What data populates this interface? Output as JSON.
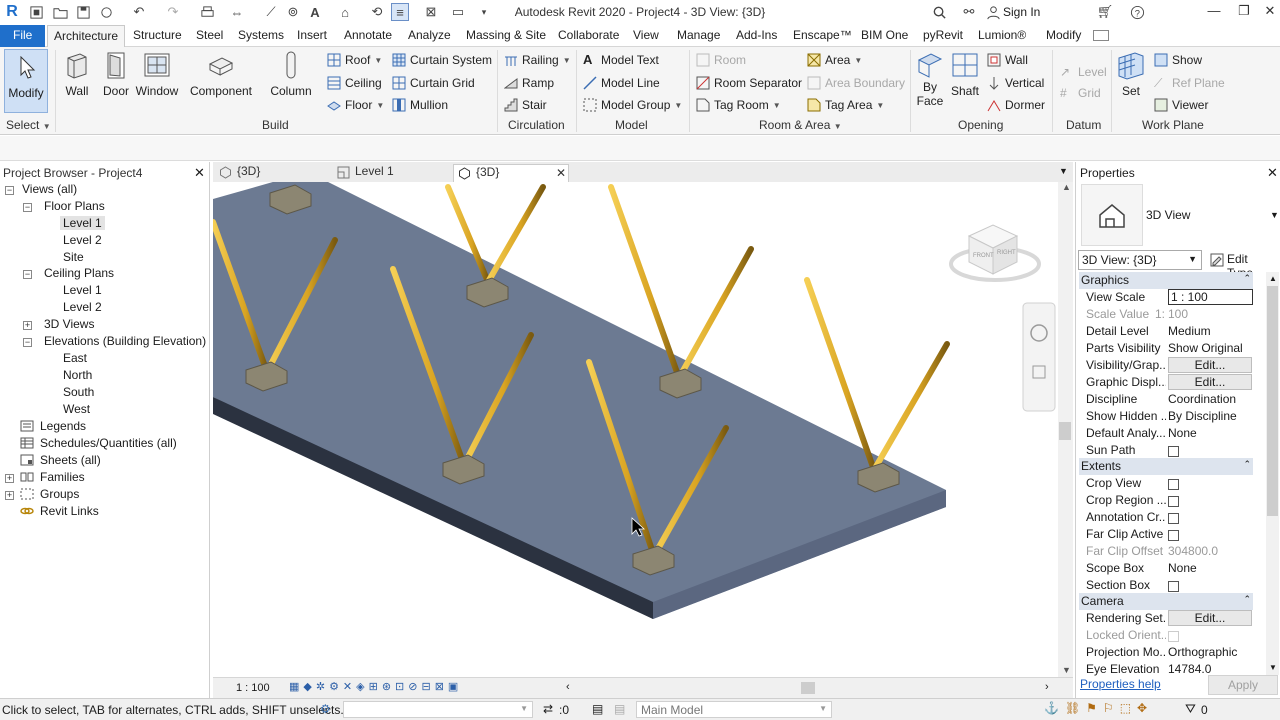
{
  "window": {
    "title": "Autodesk Revit 2020 - Project4 - 3D View: {3D}",
    "sign_in": "Sign In"
  },
  "menu": {
    "tabs": [
      "File",
      "Architecture",
      "Structure",
      "Steel",
      "Systems",
      "Insert",
      "Annotate",
      "Analyze",
      "Massing & Site",
      "Collaborate",
      "View",
      "Manage",
      "Add-Ins",
      "Enscape™",
      "BIM One",
      "pyRevit",
      "Lumion®",
      "Modify"
    ]
  },
  "ribbon": {
    "modify": "Modify",
    "select_panel": "Select",
    "build": {
      "wall": "Wall",
      "door": "Door",
      "window": "Window",
      "component": "Component",
      "column": "Column",
      "roof": "Roof",
      "ceiling": "Ceiling",
      "floor": "Floor",
      "curtain_system": "Curtain System",
      "curtain_grid": "Curtain Grid",
      "mullion": "Mullion",
      "panel": "Build"
    },
    "circulation": {
      "railing": "Railing",
      "ramp": "Ramp",
      "stair": "Stair",
      "panel": "Circulation"
    },
    "model": {
      "model_text": "Model Text",
      "model_line": "Model Line",
      "model_group": "Model Group",
      "panel": "Model"
    },
    "room_area": {
      "room": "Room",
      "room_separator": "Room Separator",
      "tag_room": "Tag Room",
      "area": "Area",
      "area_boundary": "Area Boundary",
      "tag_area": "Tag Area",
      "panel": "Room & Area"
    },
    "opening": {
      "by_face_1": "By",
      "by_face_2": "Face",
      "shaft": "Shaft",
      "wall": "Wall",
      "vertical": "Vertical",
      "dormer": "Dormer",
      "panel": "Opening"
    },
    "datum": {
      "level": "Level",
      "grid": "Grid",
      "panel": "Datum"
    },
    "work_plane": {
      "set": "Set",
      "show": "Show",
      "ref_plane": "Ref Plane",
      "viewer": "Viewer",
      "panel": "Work Plane"
    }
  },
  "view_tabs": [
    {
      "label": "{3D}",
      "active": false
    },
    {
      "label": "Level 1",
      "active": false
    },
    {
      "label": "{3D}",
      "active": true
    }
  ],
  "project_browser": {
    "title": "Project Browser - Project4",
    "items": [
      "Views (all)",
      "Floor Plans",
      "Level 1",
      "Level 2",
      "Site",
      "Ceiling Plans",
      "Level 1",
      "Level 2",
      "3D Views",
      "Elevations (Building Elevation)",
      "East",
      "North",
      "South",
      "West",
      "Legends",
      "Schedules/Quantities (all)",
      "Sheets (all)",
      "Families",
      "Groups",
      "Revit Links"
    ]
  },
  "viewcube": {
    "front": "FRONT",
    "right": "RIGHT"
  },
  "view_control": {
    "scale": "1 : 100"
  },
  "properties": {
    "title": "Properties",
    "type_name": "3D View",
    "selector": "3D View: {3D}",
    "edit_type": "Edit Type",
    "groups": {
      "graphics": "Graphics",
      "extents": "Extents",
      "camera": "Camera"
    },
    "rows": {
      "view_scale": {
        "k": "View Scale",
        "v": "1 : 100"
      },
      "scale_value": {
        "k": "Scale Value",
        "v1": "1:",
        "v": "100"
      },
      "detail_level": {
        "k": "Detail Level",
        "v": "Medium"
      },
      "parts_visibility": {
        "k": "Parts Visibility",
        "v": "Show Original"
      },
      "visibility_graphics": {
        "k": "Visibility/Grap...",
        "v": "Edit..."
      },
      "graphic_display": {
        "k": "Graphic Displ...",
        "v": "Edit..."
      },
      "discipline": {
        "k": "Discipline",
        "v": "Coordination"
      },
      "show_hidden": {
        "k": "Show Hidden ...",
        "v": "By Discipline"
      },
      "default_analysis": {
        "k": "Default Analy...",
        "v": "None"
      },
      "sun_path": {
        "k": "Sun Path"
      },
      "crop_view": {
        "k": "Crop View"
      },
      "crop_region": {
        "k": "Crop Region ..."
      },
      "annotation_crop": {
        "k": "Annotation Cr..."
      },
      "far_clip_active": {
        "k": "Far Clip Active"
      },
      "far_clip_offset": {
        "k": "Far Clip Offset",
        "v": "304800.0"
      },
      "scope_box": {
        "k": "Scope Box",
        "v": "None"
      },
      "section_box": {
        "k": "Section Box"
      },
      "rendering_settings": {
        "k": "Rendering Set...",
        "v": "Edit..."
      },
      "locked_orientation": {
        "k": "Locked Orient..."
      },
      "projection_mode": {
        "k": "Projection Mo...",
        "v": "Orthographic"
      },
      "eye_elevation": {
        "k": "Eye Elevation",
        "v": "14784.0"
      }
    },
    "help": "Properties help",
    "apply": "Apply"
  },
  "status_bar": {
    "message": "Click to select, TAB for alternates, CTRL adds, SHIFT unselects.",
    "zero": ":0",
    "model": "Main Model",
    "filter_count": "0"
  },
  "colors": {
    "accent": "#1f6fcb",
    "slab_top": "#6c7a92",
    "slab_side": "#2b3240",
    "rod": "#d9a422",
    "footing": "#8c8672"
  }
}
